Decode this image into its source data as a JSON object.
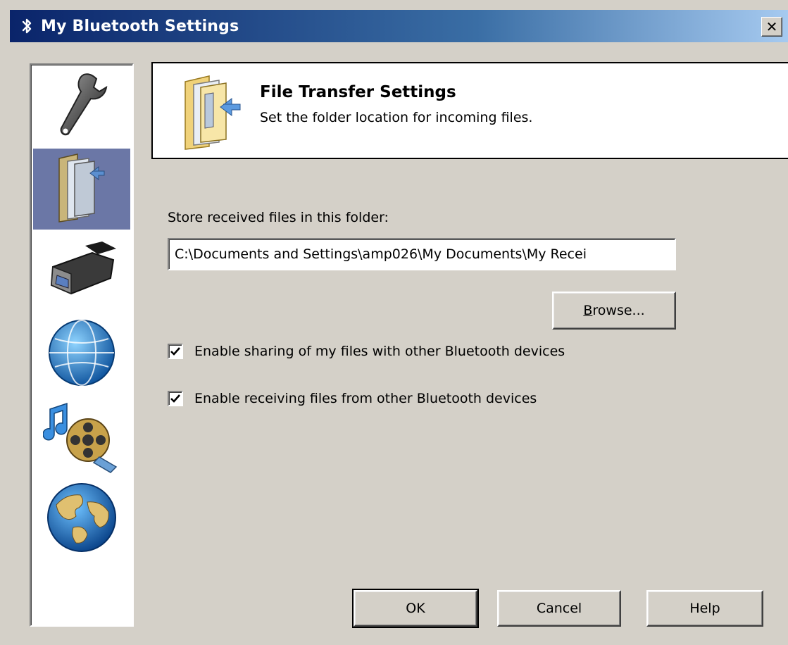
{
  "window": {
    "title": "My Bluetooth Settings"
  },
  "sidebar": {
    "items": [
      {
        "icon": "wrench-icon",
        "selected": false
      },
      {
        "icon": "folder-transfer-icon",
        "selected": true
      },
      {
        "icon": "serial-port-icon",
        "selected": false
      },
      {
        "icon": "network-globe-icon",
        "selected": false
      },
      {
        "icon": "multimedia-icon",
        "selected": false
      },
      {
        "icon": "world-globe-icon",
        "selected": false
      }
    ]
  },
  "header": {
    "title": "File Transfer Settings",
    "subtitle": "Set the folder location for incoming files."
  },
  "form": {
    "folder_label": "Store received files in this folder:",
    "folder_value": "C:\\Documents and Settings\\amp026\\My Documents\\My Recei",
    "browse_label_mnemonic": "B",
    "browse_label_rest": "rowse...",
    "checkboxes": [
      {
        "label": "Enable sharing of my files with other Bluetooth devices",
        "checked": true
      },
      {
        "label": "Enable receiving files from other Bluetooth devices",
        "checked": true
      }
    ]
  },
  "footer": {
    "ok_label": "OK",
    "cancel_label": "Cancel",
    "help_label": "Help"
  },
  "colors": {
    "titlebar_start": "#0a246a",
    "titlebar_end": "#a6caf0",
    "selected_nav": "#6b77a6",
    "dialog_bg": "#d4d0c8"
  }
}
